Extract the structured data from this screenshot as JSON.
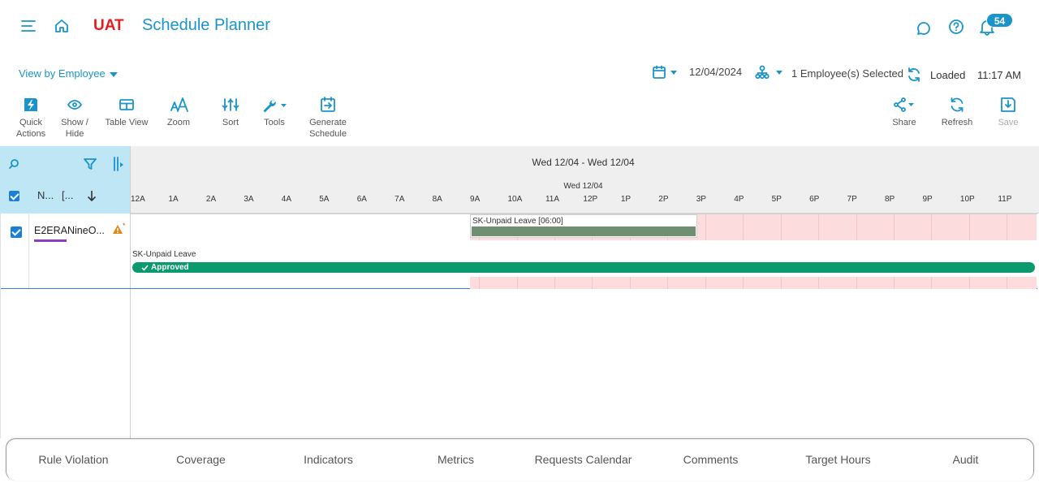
{
  "header": {
    "env": "UAT",
    "title": "Schedule Planner",
    "notification_count": "54",
    "accent": "#1a94c9",
    "env_color": "#e02020"
  },
  "subheader": {
    "view_by": "View by Employee",
    "date": "12/04/2024",
    "employees_selected": "1 Employee(s) Selected",
    "status": "Loaded",
    "time": "11:17 AM"
  },
  "toolbar": {
    "quick_actions": [
      "Quick",
      "Actions"
    ],
    "show_hide": [
      "Show /",
      "Hide"
    ],
    "table_view": "Table View",
    "zoom": "Zoom",
    "sort": "Sort",
    "tools": "Tools",
    "generate_schedule": [
      "Generate",
      "Schedule"
    ],
    "share": "Share",
    "refresh": "Refresh",
    "save": "Save"
  },
  "grid": {
    "col_name": "N...",
    "col_extra": "[...",
    "range": "Wed 12/04 - Wed 12/04",
    "day": "Wed 12/04",
    "hours": [
      "12A",
      "1A",
      "2A",
      "3A",
      "4A",
      "5A",
      "6A",
      "7A",
      "8A",
      "9A",
      "10A",
      "11A",
      "12P",
      "1P",
      "2P",
      "3P",
      "4P",
      "5P",
      "6P",
      "7P",
      "8P",
      "9P",
      "10P",
      "11P"
    ],
    "rows": [
      {
        "employee": "E2ERANineO...",
        "warning_mark": "*",
        "shift_label": "SK-Unpaid Leave [06:00]",
        "request_label": "SK-Unpaid Leave",
        "request_status": "Approved"
      }
    ],
    "colors": {
      "shift": "#6f8f70",
      "approved": "#0a9a6e",
      "unavailable": "#fcdcdc",
      "header_left": "#bfe6f5"
    }
  },
  "bottom_tabs": [
    "Rule Violation",
    "Coverage",
    "Indicators",
    "Metrics",
    "Requests Calendar",
    "Comments",
    "Target Hours",
    "Audit"
  ]
}
